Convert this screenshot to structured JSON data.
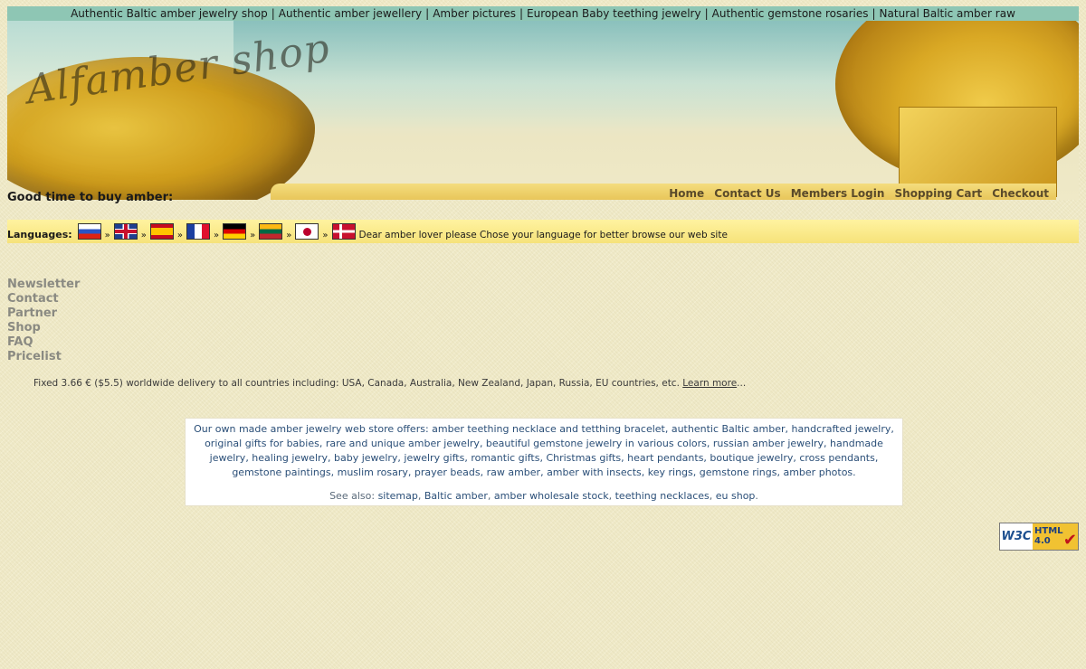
{
  "top_links": [
    "Authentic Baltic amber jewelry shop",
    "Authentic amber jewellery",
    "Amber pictures",
    "European Baby teething jewelry",
    "Authentic gemstone rosaries",
    "Natural Baltic amber raw"
  ],
  "top_separator": "|",
  "logo": "Alfamber shop",
  "menu": [
    "Home",
    "Contact Us",
    "Members Login",
    "Shopping Cart",
    "Checkout"
  ],
  "good_time": "Good time to buy amber:",
  "languages": {
    "label": "Languages:",
    "separator": "»",
    "flags": [
      "russian",
      "english",
      "spanish",
      "french",
      "german",
      "lithuanian",
      "japanese",
      "danish"
    ],
    "notice": "Dear amber lover please Chose your language for better browse our web site"
  },
  "left_nav": [
    "Newsletter",
    "Contact",
    "Partner",
    "Shop",
    "FAQ",
    "Pricelist"
  ],
  "delivery": {
    "text": "Fixed 3.66 € ($5.5) worldwide delivery to all countries including: USA, Canada, Australia, New Zealand, Japan, Russia, EU countries, etc.",
    "link": "Learn more",
    "suffix": "..."
  },
  "offers": {
    "text": "Our own made amber jewelry web store offers: amber teething necklace and tetthing bracelet, authentic Baltic amber, handcrafted jewelry, original gifts for babies, rare and unique amber jewelry,  beautiful gemstone jewelry in various colors, russian amber jewelry, handmade jewelry, healing jewelry, baby jewelry, jewelry gifts, romantic gifts, Christmas gifts, heart pendants, boutique jewelry, cross pendants, gemstone paintings, muslim rosary, prayer beads, raw amber, amber with insects, key rings, gemstone rings, amber photos.",
    "see_also_label": "See also:",
    "see_also_links": [
      "sitemap",
      "Baltic amber",
      "amber wholesale stock",
      "teething necklaces",
      "eu shop"
    ],
    "see_also_end": "."
  },
  "badge": {
    "w3c": "W3C",
    "html": "HTML",
    "version": "4.0",
    "check": "✔"
  },
  "colors": {
    "background": "#efe9c7",
    "topbar": "#8ec6b4",
    "language_bar": "#f6e27a",
    "menu_bar": "#e8c65a",
    "offer_text": "#2b4f78",
    "nav_text": "#8a8a82"
  }
}
